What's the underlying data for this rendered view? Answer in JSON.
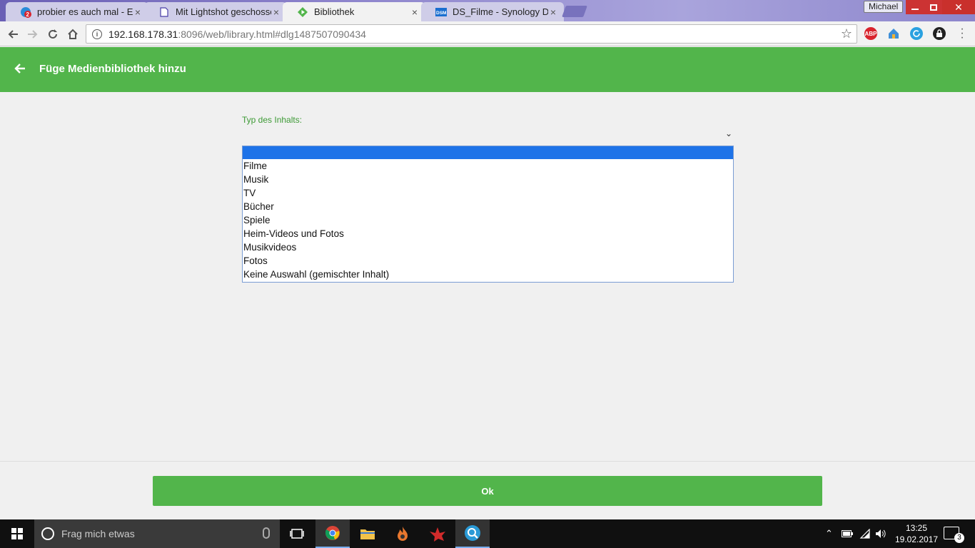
{
  "browser": {
    "tabs": [
      {
        "title": "probier es auch mal - Em",
        "icon": "emby-forum-icon",
        "badge": "2"
      },
      {
        "title": "Mit Lightshot geschossen",
        "icon": "document-icon"
      },
      {
        "title": "Bibliothek",
        "icon": "emby-play-icon",
        "active": true
      },
      {
        "title": "DS_Filme - Synology Disk",
        "icon": "dsm-icon",
        "badge": "DSM"
      }
    ],
    "profile_name": "Michael",
    "url_host": "192.168.178.31",
    "url_path": ":8096/web/library.html#dlg1487507090434",
    "extensions": [
      {
        "name": "adblock-icon",
        "label": "ABP",
        "color": "#d9232d"
      },
      {
        "name": "home-extension-icon",
        "label": "",
        "color": "#3f8fd8"
      },
      {
        "name": "refresh-extension-icon",
        "label": "",
        "color": "#2aa1e0"
      },
      {
        "name": "lock-extension-icon",
        "label": "",
        "color": "#222222"
      }
    ]
  },
  "app": {
    "header_title": "Füge Medienbibliothek hinzu",
    "accent_color": "#52b54b",
    "field_label": "Typ des Inhalts:",
    "options": [
      "",
      "Filme",
      "Musik",
      "TV",
      "Bücher",
      "Spiele",
      "Heim-Videos und Fotos",
      "Musikvideos",
      "Fotos",
      "Keine Auswahl (gemischter Inhalt)"
    ],
    "selected_index": 0,
    "ok_label": "Ok"
  },
  "taskbar": {
    "search_placeholder": "Frag mich etwas",
    "time": "13:25",
    "date": "19.02.2017",
    "notification_count": "3"
  }
}
